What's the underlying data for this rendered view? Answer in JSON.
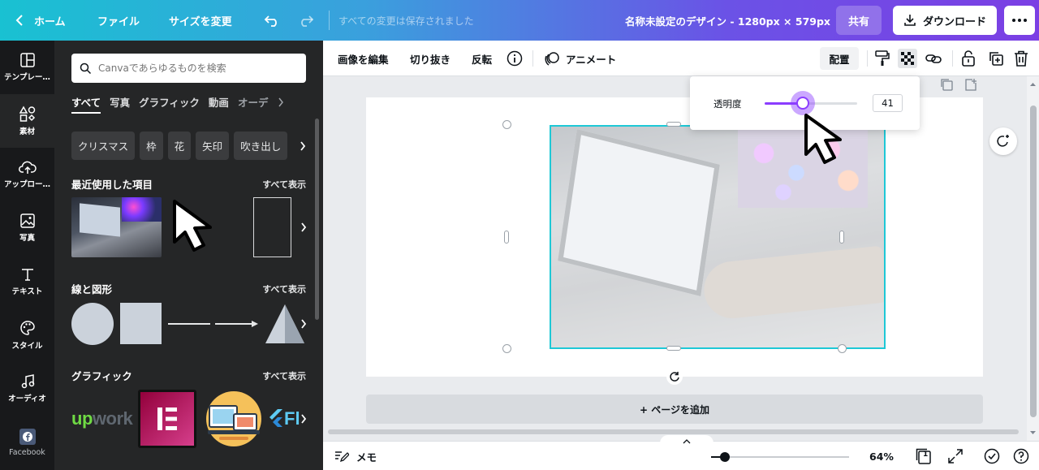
{
  "topbar": {
    "home": "ホーム",
    "file": "ファイル",
    "resize": "サイズを変更",
    "save_status": "すべての変更は保存されました",
    "title": "名称未設定のデザイン - 1280px × 579px",
    "share": "共有",
    "download": "ダウンロード"
  },
  "rail": {
    "items": [
      {
        "label": "テンプレー…",
        "icon": "layout-icon"
      },
      {
        "label": "素材",
        "icon": "shapes-icon"
      },
      {
        "label": "アップロー…",
        "icon": "cloud-upload-icon"
      },
      {
        "label": "写真",
        "icon": "image-icon"
      },
      {
        "label": "テキスト",
        "icon": "text-icon"
      },
      {
        "label": "スタイル",
        "icon": "palette-icon"
      },
      {
        "label": "オーディオ",
        "icon": "music-note-icon"
      },
      {
        "label": "Facebook",
        "icon": "facebook-icon"
      }
    ]
  },
  "panel": {
    "search_placeholder": "Canvaであらゆるものを検索",
    "tabs": [
      "すべて",
      "写真",
      "グラフィック",
      "動画",
      "オーデ"
    ],
    "chips": [
      "クリスマス",
      "枠",
      "花",
      "矢印",
      "吹き出し"
    ],
    "recent": {
      "title": "最近使用した項目",
      "see_all": "すべて表示"
    },
    "shapes": {
      "title": "線と図形",
      "see_all": "すべて表示"
    },
    "graphics": {
      "title": "グラフィック",
      "see_all": "すべて表示",
      "upwork_a": "up",
      "upwork_b": "work",
      "flutter": "Fl"
    }
  },
  "context_toolbar": {
    "edit_image": "画像を編集",
    "crop": "切り抜き",
    "flip": "反転",
    "animate": "アニメート",
    "arrange": "配置"
  },
  "transparency": {
    "label": "透明度",
    "value": "41",
    "level": 0.41,
    "accent": "#8b3dff"
  },
  "canvas": {
    "add_page": "+ ページを追加"
  },
  "bottombar": {
    "notes": "メモ",
    "zoom": "64%",
    "zoom_level": 0.1,
    "page_count": "1"
  },
  "colors": {
    "selection": "#1ec8d6",
    "panel_bg": "#252627",
    "rail_bg": "#18191b"
  }
}
